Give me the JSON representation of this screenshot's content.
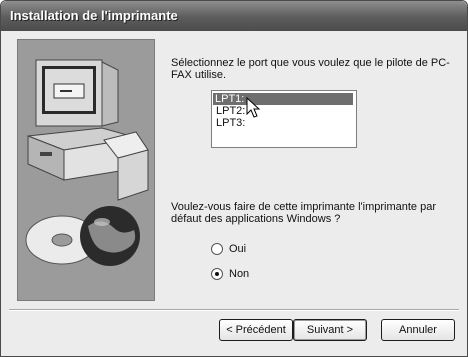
{
  "window": {
    "title": "Installation de l'imprimante"
  },
  "prompt_port": "Sélectionnez le port que vous voulez que le pilote de PC-FAX utilise.",
  "ports": [
    "LPT1:",
    "LPT2:",
    "LPT3:"
  ],
  "selected_port": "LPT1:",
  "prompt_default": "Voulez-vous faire de cette imprimante l'imprimante par défaut des applications Windows ?",
  "options": {
    "yes_label": "Oui",
    "no_label": "Non",
    "selected": "Non"
  },
  "buttons": {
    "back_label": "< Précédent",
    "next_label": "Suivant >",
    "cancel_label": "Annuler"
  }
}
